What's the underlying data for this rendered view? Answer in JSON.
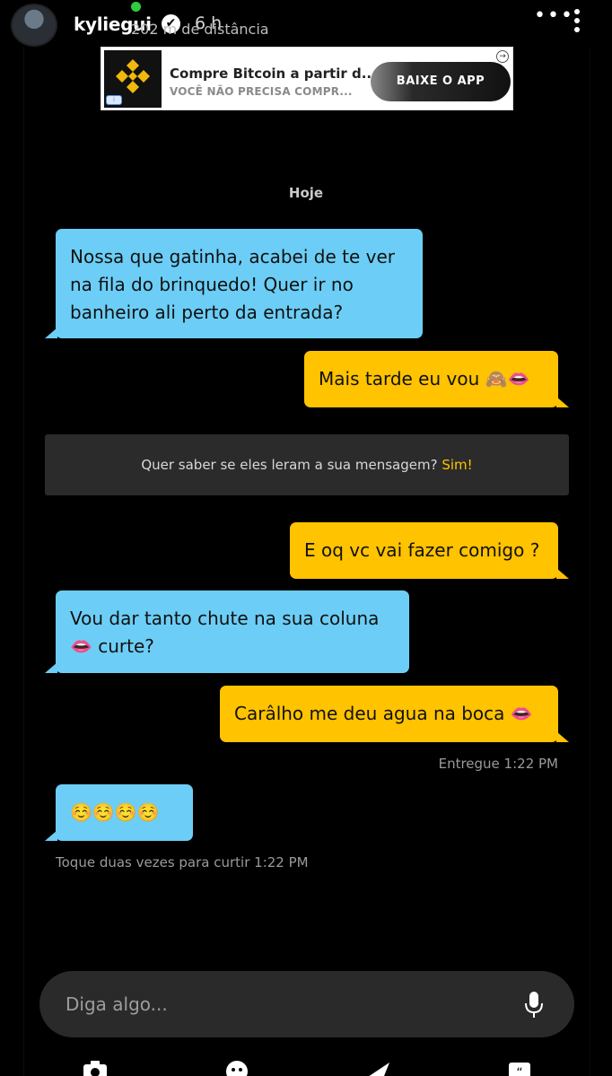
{
  "story": {
    "username": "kyliegui",
    "time_ago": "6 h",
    "distance": "202 m de distância",
    "verified_glyph": "✔",
    "more_glyph": "•••"
  },
  "ad": {
    "title": "Compre Bitcoin a partir d...",
    "subtitle": "VOCÊ NÃO PRECISA COMPR...",
    "cta": "BAIXE O APP",
    "brand_color": "#F0B90B"
  },
  "chat": {
    "day_label": "Hoje",
    "messages": [
      {
        "direction": "in",
        "text": "Nossa que gatinha, acabei de te ver na fila do brinquedo! Quer ir no banheiro ali perto da entrada?"
      },
      {
        "direction": "out",
        "text": "Mais tarde eu vou 🙈👄"
      },
      {
        "direction": "out",
        "text": "E oq vc vai fazer comigo ?"
      },
      {
        "direction": "in",
        "text": "Vou dar tanto chute na sua coluna 👄 curte?"
      },
      {
        "direction": "out",
        "text": "Carâlho me deu agua na boca 👄"
      },
      {
        "direction": "in",
        "text": "☺️☺️☺️☺️"
      }
    ],
    "read_receipt": {
      "question": "Quer saber se eles leram a sua mensagem?",
      "link": "Sim!"
    },
    "delivered_status": "Entregue 1:22 PM",
    "like_hint": "Toque duas vezes para curtir  1:22 PM"
  },
  "input": {
    "placeholder": "Diga algo..."
  },
  "colors": {
    "incoming_bubble": "#6CCEF6",
    "outgoing_bubble": "#FFC300",
    "background": "#000000"
  },
  "icons": [
    "camera-icon",
    "sticker-icon",
    "send-icon",
    "quote-icon",
    "mic-icon"
  ]
}
